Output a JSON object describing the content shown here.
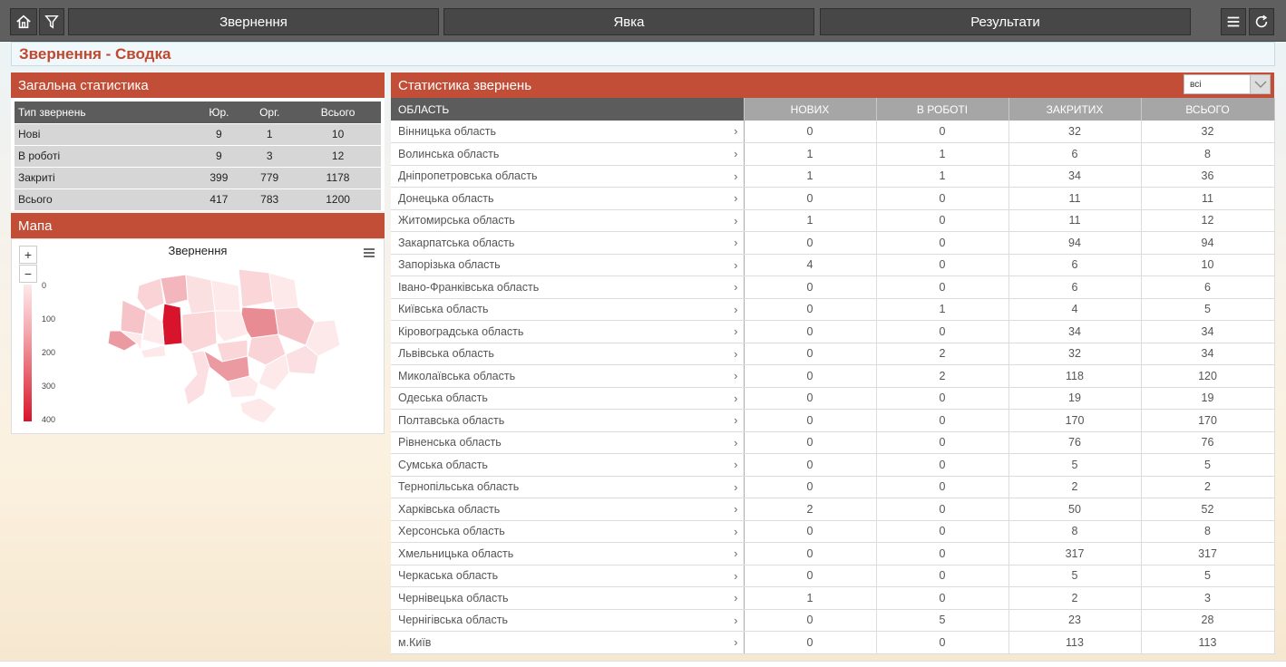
{
  "toolbar": {
    "tabs": [
      "Звернення",
      "Явка",
      "Результати"
    ],
    "icons": [
      "home-icon",
      "filter-icon",
      "menu-icon",
      "refresh-icon"
    ]
  },
  "page": {
    "title": "Звернення - Сводка"
  },
  "general": {
    "title": "Загальна статистика",
    "headers": [
      "Тип звернень",
      "Юр.",
      "Орг.",
      "Всього"
    ],
    "rows": [
      [
        "Нові",
        "9",
        "1",
        "10"
      ],
      [
        "В роботі",
        "9",
        "3",
        "12"
      ],
      [
        "Закриті",
        "399",
        "779",
        "1178"
      ],
      [
        "Всього",
        "417",
        "783",
        "1200"
      ]
    ]
  },
  "map": {
    "panel_title": "Мапа",
    "chart_title": "Звернення",
    "zoom_in": "+",
    "zoom_out": "−",
    "legend": [
      "0",
      "100",
      "200",
      "300",
      "400"
    ],
    "colors": {
      "low": "#fde9ea",
      "high": "#d8142c"
    }
  },
  "stats": {
    "title": "Статистика звернень",
    "filter_value": "всі",
    "headers": [
      "ОБЛАСТЬ",
      "НОВИХ",
      "В РОБОТІ",
      "ЗАКРИТИХ",
      "ВСЬОГО"
    ],
    "rows": [
      [
        "Вінницька область",
        "0",
        "0",
        "32",
        "32"
      ],
      [
        "Волинська область",
        "1",
        "1",
        "6",
        "8"
      ],
      [
        "Дніпропетровська область",
        "1",
        "1",
        "34",
        "36"
      ],
      [
        "Донецька область",
        "0",
        "0",
        "11",
        "11"
      ],
      [
        "Житомирська область",
        "1",
        "0",
        "11",
        "12"
      ],
      [
        "Закарпатська область",
        "0",
        "0",
        "94",
        "94"
      ],
      [
        "Запорізька область",
        "4",
        "0",
        "6",
        "10"
      ],
      [
        "Івано-Франківська область",
        "0",
        "0",
        "6",
        "6"
      ],
      [
        "Київська область",
        "0",
        "1",
        "4",
        "5"
      ],
      [
        "Кіровоградська область",
        "0",
        "0",
        "34",
        "34"
      ],
      [
        "Львівська область",
        "0",
        "2",
        "32",
        "34"
      ],
      [
        "Миколаївська область",
        "0",
        "2",
        "118",
        "120"
      ],
      [
        "Одеська область",
        "0",
        "0",
        "19",
        "19"
      ],
      [
        "Полтавська область",
        "0",
        "0",
        "170",
        "170"
      ],
      [
        "Рівненська область",
        "0",
        "0",
        "76",
        "76"
      ],
      [
        "Сумська область",
        "0",
        "0",
        "5",
        "5"
      ],
      [
        "Тернопільська область",
        "0",
        "0",
        "2",
        "2"
      ],
      [
        "Харківська область",
        "2",
        "0",
        "50",
        "52"
      ],
      [
        "Херсонська область",
        "0",
        "0",
        "8",
        "8"
      ],
      [
        "Хмельницька область",
        "0",
        "0",
        "317",
        "317"
      ],
      [
        "Черкаська область",
        "0",
        "0",
        "5",
        "5"
      ],
      [
        "Чернівецька область",
        "1",
        "0",
        "2",
        "3"
      ],
      [
        "Чернігівська область",
        "0",
        "5",
        "23",
        "28"
      ],
      [
        "м.Київ",
        "0",
        "0",
        "113",
        "113"
      ]
    ]
  }
}
